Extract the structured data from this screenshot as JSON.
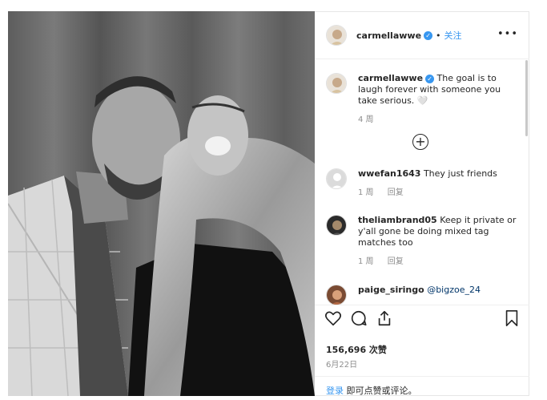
{
  "post": {
    "username": "carmellawwe",
    "separator": "•",
    "follow_label": "关注",
    "more_label": "•••"
  },
  "caption": {
    "username": "carmellawwe",
    "text": "The goal is to laugh forever with someone you take serious. 🤍",
    "time": "4 周"
  },
  "comments": [
    {
      "username": "wwefan1643",
      "text": "They just friends",
      "time": "1 周",
      "reply": "回复"
    },
    {
      "username": "theliambrand05",
      "text": "Keep it private or y'all gone be doing mixed tag matches too",
      "time": "1 周",
      "reply": "回复"
    },
    {
      "username": "paige_siringo",
      "text": "@bigzoe_24",
      "time": "",
      "reply": ""
    }
  ],
  "load_more": "+",
  "stats": {
    "likes": "156,696 次赞",
    "date": "6月22日"
  },
  "login": {
    "link": "登录",
    "text": " 即可点赞或评论。"
  },
  "colors": {
    "accent": "#3897f0",
    "muted": "#8e8e8e",
    "text": "#262626"
  }
}
